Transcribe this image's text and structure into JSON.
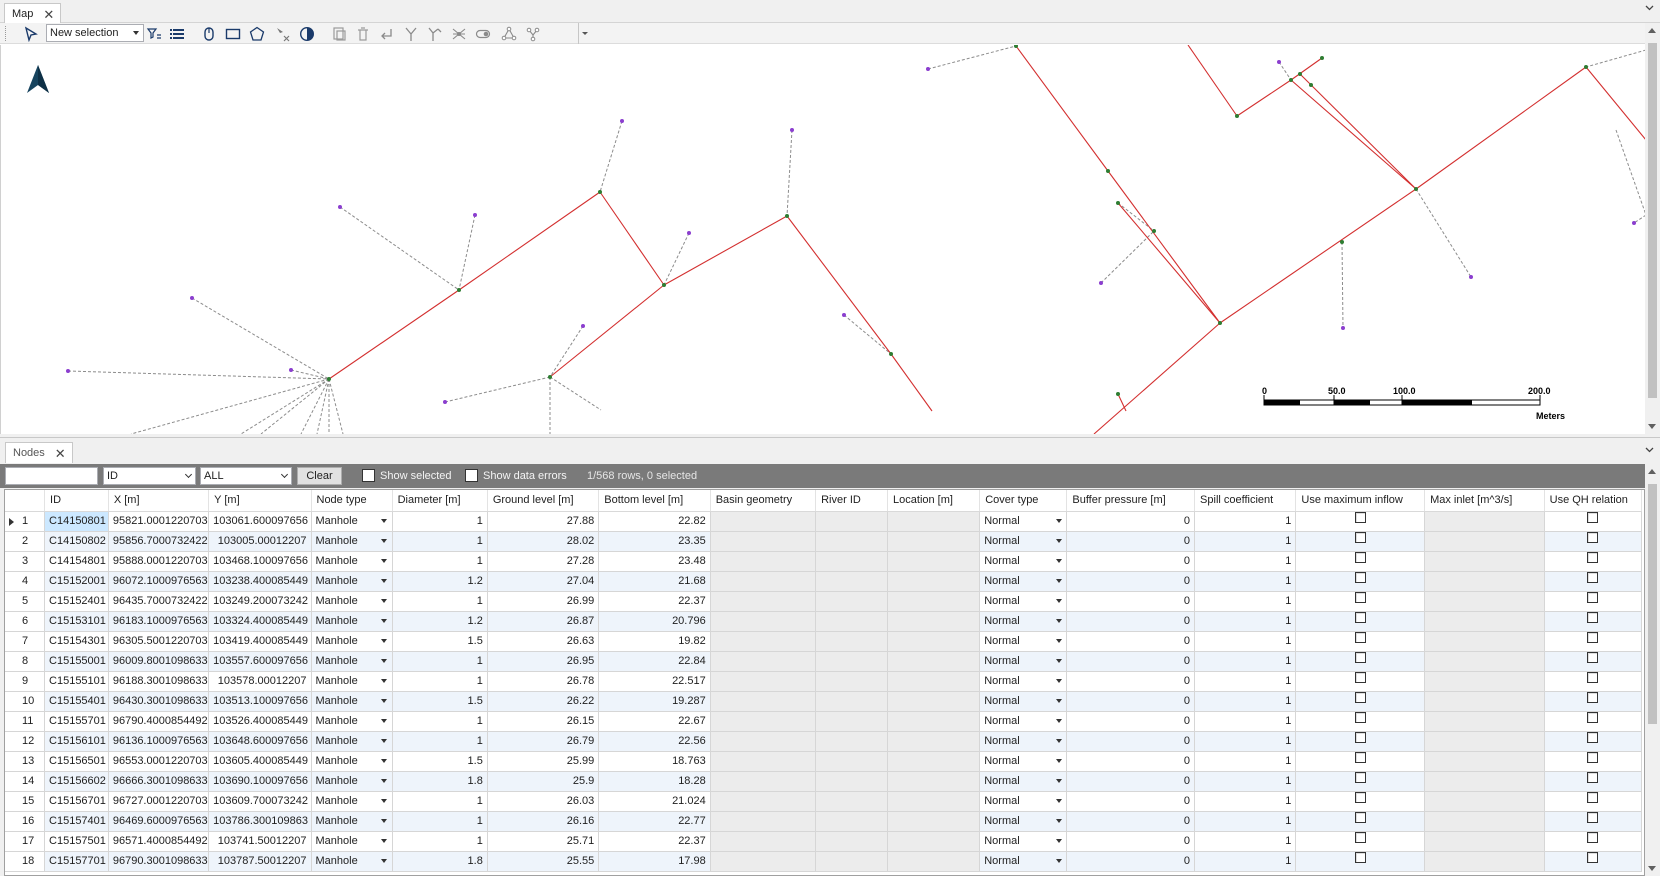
{
  "map_pane": {
    "tab_label": "Map",
    "close_glyph": "✕",
    "toolbar": {
      "selection_mode": "New selection",
      "icons": [
        "select-arrow-icon",
        "filter-list-icon",
        "list-icon",
        "pan-mouse-icon",
        "rectangle-select-icon",
        "polygon-select-icon",
        "clear-selection-icon",
        "contrast-icon",
        "copy-icon",
        "delete-icon",
        "undo-icon",
        "split-icon",
        "branch-icon",
        "network-icon",
        "toggle-icon",
        "nodes-icon",
        "connect-icon"
      ]
    },
    "north_arrow": "north-arrow-icon",
    "scale_bar": {
      "labels": [
        "0",
        "50.0",
        "100.0",
        "200.0"
      ],
      "unit": "Meters"
    },
    "colors": {
      "pipe": "#d32f2f",
      "link": "#8c8c8c",
      "node": "#2e7d32",
      "outlet": "#8b3ecf"
    }
  },
  "nodes_pane": {
    "tab_label": "Nodes",
    "close_glyph": "✕",
    "filter": {
      "search_value": "",
      "field": "ID",
      "scope": "ALL",
      "clear_label": "Clear",
      "show_selected_label": "Show selected",
      "show_errors_label": "Show data errors",
      "status": "1/568 rows, 0 selected"
    },
    "columns": [
      "ID",
      "X [m]",
      "Y [m]",
      "Node type",
      "Diameter [m]",
      "Ground level [m]",
      "Bottom level [m]",
      "Basin geometry",
      "River ID",
      "Location [m]",
      "Cover type",
      "Buffer pressure [m]",
      "Spill coefficient",
      "Use maximum inflow",
      "Max inlet [m^3/s]",
      "Use QH relation"
    ],
    "rows": [
      {
        "n": "1",
        "id": "C14150801",
        "x": "95821.0001220703",
        "y": "103061.600097656",
        "type": "Manhole",
        "d": "1",
        "g": "27.88",
        "b": "22.82",
        "cover": "Normal",
        "buf": "0",
        "spill": "1"
      },
      {
        "n": "2",
        "id": "C14150802",
        "x": "95856.7000732422",
        "y": "103005.00012207",
        "type": "Manhole",
        "d": "1",
        "g": "28.02",
        "b": "23.35",
        "cover": "Normal",
        "buf": "0",
        "spill": "1"
      },
      {
        "n": "3",
        "id": "C14154801",
        "x": "95888.0001220703",
        "y": "103468.100097656",
        "type": "Manhole",
        "d": "1",
        "g": "27.28",
        "b": "23.48",
        "cover": "Normal",
        "buf": "0",
        "spill": "1"
      },
      {
        "n": "4",
        "id": "C15152001",
        "x": "96072.1000976563",
        "y": "103238.400085449",
        "type": "Manhole",
        "d": "1.2",
        "g": "27.04",
        "b": "21.68",
        "cover": "Normal",
        "buf": "0",
        "spill": "1"
      },
      {
        "n": "5",
        "id": "C15152401",
        "x": "96435.7000732422",
        "y": "103249.200073242",
        "type": "Manhole",
        "d": "1",
        "g": "26.99",
        "b": "22.37",
        "cover": "Normal",
        "buf": "0",
        "spill": "1"
      },
      {
        "n": "6",
        "id": "C15153101",
        "x": "96183.1000976563",
        "y": "103324.400085449",
        "type": "Manhole",
        "d": "1.2",
        "g": "26.87",
        "b": "20.796",
        "cover": "Normal",
        "buf": "0",
        "spill": "1"
      },
      {
        "n": "7",
        "id": "C15154301",
        "x": "96305.5001220703",
        "y": "103419.400085449",
        "type": "Manhole",
        "d": "1.5",
        "g": "26.63",
        "b": "19.82",
        "cover": "Normal",
        "buf": "0",
        "spill": "1"
      },
      {
        "n": "8",
        "id": "C15155001",
        "x": "96009.8001098633",
        "y": "103557.600097656",
        "type": "Manhole",
        "d": "1",
        "g": "26.95",
        "b": "22.84",
        "cover": "Normal",
        "buf": "0",
        "spill": "1"
      },
      {
        "n": "9",
        "id": "C15155101",
        "x": "96188.3001098633",
        "y": "103578.00012207",
        "type": "Manhole",
        "d": "1",
        "g": "26.78",
        "b": "22.517",
        "cover": "Normal",
        "buf": "0",
        "spill": "1"
      },
      {
        "n": "10",
        "id": "C15155401",
        "x": "96430.3001098633",
        "y": "103513.100097656",
        "type": "Manhole",
        "d": "1.5",
        "g": "26.22",
        "b": "19.287",
        "cover": "Normal",
        "buf": "0",
        "spill": "1"
      },
      {
        "n": "11",
        "id": "C15155701",
        "x": "96790.4000854492",
        "y": "103526.400085449",
        "type": "Manhole",
        "d": "1",
        "g": "26.15",
        "b": "22.67",
        "cover": "Normal",
        "buf": "0",
        "spill": "1"
      },
      {
        "n": "12",
        "id": "C15156101",
        "x": "96136.1000976563",
        "y": "103648.600097656",
        "type": "Manhole",
        "d": "1",
        "g": "26.79",
        "b": "22.56",
        "cover": "Normal",
        "buf": "0",
        "spill": "1"
      },
      {
        "n": "13",
        "id": "C15156501",
        "x": "96553.0001220703",
        "y": "103605.400085449",
        "type": "Manhole",
        "d": "1.5",
        "g": "25.99",
        "b": "18.763",
        "cover": "Normal",
        "buf": "0",
        "spill": "1"
      },
      {
        "n": "14",
        "id": "C15156602",
        "x": "96666.3001098633",
        "y": "103690.100097656",
        "type": "Manhole",
        "d": "1.8",
        "g": "25.9",
        "b": "18.28",
        "cover": "Normal",
        "buf": "0",
        "spill": "1"
      },
      {
        "n": "15",
        "id": "C15156701",
        "x": "96727.0001220703",
        "y": "103609.700073242",
        "type": "Manhole",
        "d": "1",
        "g": "26.03",
        "b": "21.024",
        "cover": "Normal",
        "buf": "0",
        "spill": "1"
      },
      {
        "n": "16",
        "id": "C15157401",
        "x": "96469.6000976563",
        "y": "103786.300109863",
        "type": "Manhole",
        "d": "1",
        "g": "26.16",
        "b": "22.77",
        "cover": "Normal",
        "buf": "0",
        "spill": "1"
      },
      {
        "n": "17",
        "id": "C15157501",
        "x": "96571.4000854492",
        "y": "103741.50012207",
        "type": "Manhole",
        "d": "1",
        "g": "25.71",
        "b": "22.37",
        "cover": "Normal",
        "buf": "0",
        "spill": "1"
      },
      {
        "n": "18",
        "id": "C15157701",
        "x": "96790.3001098633",
        "y": "103787.50012207",
        "type": "Manhole",
        "d": "1.8",
        "g": "25.55",
        "b": "17.98",
        "cover": "Normal",
        "buf": "0",
        "spill": "1"
      }
    ]
  }
}
